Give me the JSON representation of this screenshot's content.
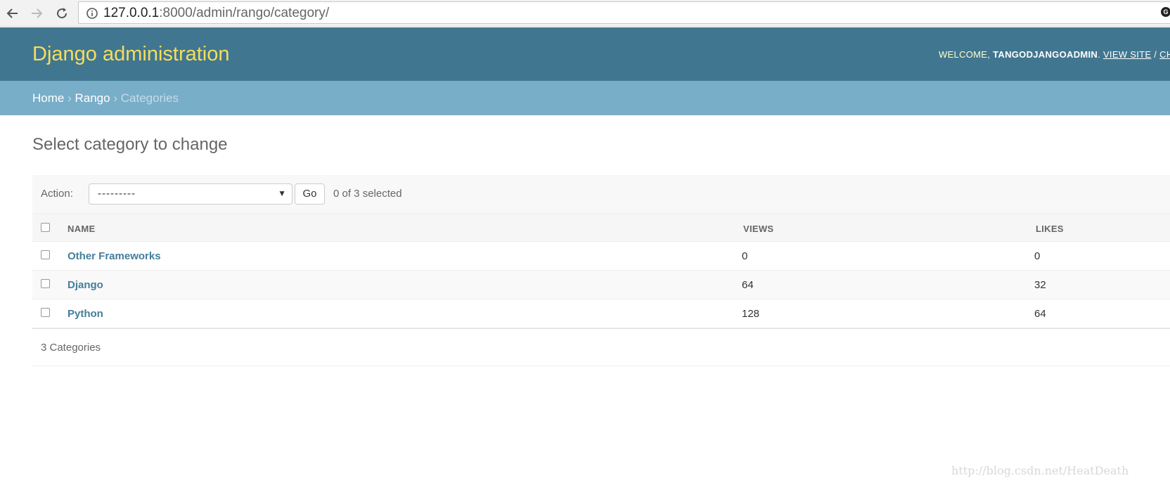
{
  "browser": {
    "url_host": "127.0.0.1",
    "url_rest": ":8000/admin/rango/category/"
  },
  "header": {
    "title": "Django administration",
    "welcome": "WELCOME, ",
    "username": "TANGODJANGOADMIN",
    "dot": ". ",
    "view_site": "VIEW SITE",
    "slash": " / ",
    "cut_link": "CH"
  },
  "breadcrumbs": {
    "home": "Home",
    "app": "Rango",
    "current": "Categories",
    "separator": "›"
  },
  "page": {
    "title": "Select category to change"
  },
  "actions": {
    "label": "Action:",
    "selected_value": "---------",
    "go_label": "Go",
    "selected_count": "0 of 3 selected"
  },
  "table": {
    "columns": [
      "NAME",
      "VIEWS",
      "LIKES"
    ],
    "rows": [
      {
        "name": "Other Frameworks",
        "views": "0",
        "likes": "0"
      },
      {
        "name": "Django",
        "views": "64",
        "likes": "32"
      },
      {
        "name": "Python",
        "views": "128",
        "likes": "64"
      }
    ]
  },
  "paginator": {
    "text": "3 Categories"
  },
  "watermark": "http://blog.csdn.net/HeatDeath"
}
